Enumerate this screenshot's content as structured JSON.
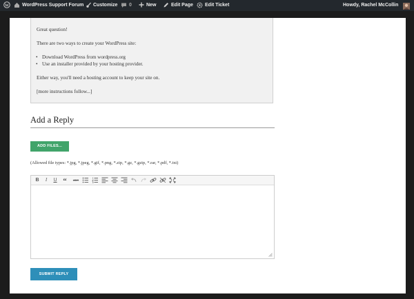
{
  "adminbar": {
    "site_name": "WordPress Support Forum",
    "customize": "Customize",
    "comments_count": "0",
    "new_label": "New",
    "edit_page": "Edit Page",
    "edit_ticket": "Edit Ticket",
    "howdy": "Howdy, Rachel McCollin"
  },
  "quote": {
    "p1": "Great question!",
    "p2": "There are two ways to create your WordPress site:",
    "list": [
      "Download WordPress from wordpress.org",
      "Use an installer provided by your hosting provider."
    ],
    "p3": "Either way, you'll need a hosting account to keep your site on.",
    "p4": "[more instructions follow...]"
  },
  "reply": {
    "title": "Add a Reply",
    "add_files_label": "ADD FILES...",
    "allowed_types": "(Allowed file types: *.jpg, *.jpeg, *.gif, *.png, *.zip, *.gz, *.gzip, *.rar, *.pdf, *.txt)",
    "submit_label": "SUBMIT REPLY",
    "editor_value": ""
  },
  "toolbar": {
    "bold": "B",
    "italic": "I",
    "underline": "U",
    "quote": "“",
    "strike": "ABC"
  },
  "icons": {
    "wp_logo": "wordpress-logo-icon",
    "customize": "paintbrush-icon",
    "comments": "comment-bubble-icon",
    "new": "plus-icon",
    "edit": "pencil-icon",
    "edit_ticket": "gear-icon"
  },
  "colors": {
    "admin_bar_bg": "#23282d",
    "add_files_btn": "#41a46a",
    "submit_btn": "#2e8fb9",
    "quote_bg": "#f1f1f1"
  }
}
